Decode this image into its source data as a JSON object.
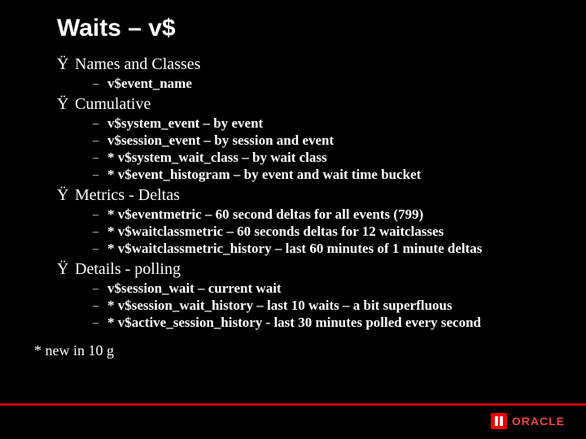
{
  "slide": {
    "title": "Waits – v$",
    "bullet_glyph": "Ÿ",
    "dash_glyph": "–",
    "sections": [
      {
        "heading": "Names and Classes",
        "items": [
          "v$event_name"
        ]
      },
      {
        "heading": "Cumulative",
        "items": [
          "v$system_event – by event",
          "v$session_event – by session and event",
          "* v$system_wait_class – by wait class",
          "* v$event_histogram – by event and wait time bucket"
        ]
      },
      {
        "heading": "Metrics - Deltas",
        "items": [
          "* v$eventmetric – 60 second deltas for all events (799)",
          "* v$waitclassmetric – 60 seconds deltas for 12 waitclasses",
          "* v$waitclassmetric_history – last 60 minutes of 1 minute deltas"
        ]
      },
      {
        "heading": "Details - polling",
        "items": [
          "v$session_wait – current wait",
          "* v$session_wait_history – last 10 waits – a bit superfluous",
          "* v$active_session_history  - last 30 minutes polled every second"
        ]
      }
    ],
    "footnote": "* new in 10 g",
    "brand": "ORACLE"
  }
}
